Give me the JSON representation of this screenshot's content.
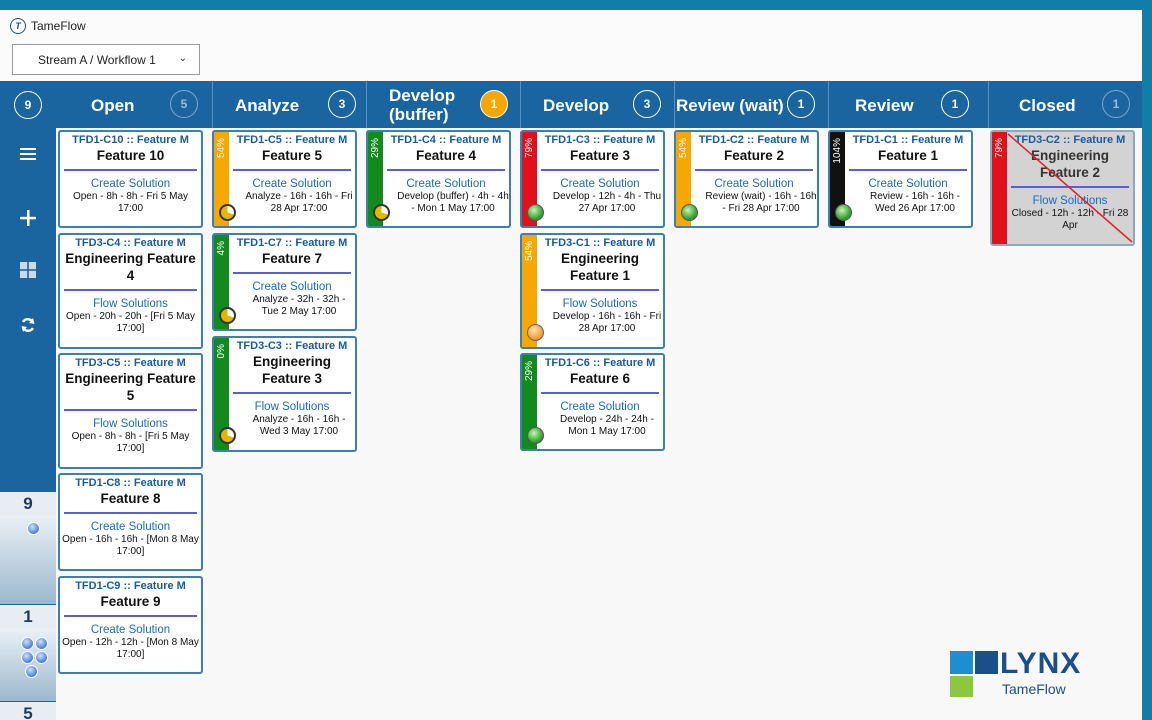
{
  "app": {
    "title": "TameFlow",
    "logo_glyph": "T"
  },
  "stream_select": {
    "value": "Stream A / Workflow 1"
  },
  "header": {
    "total_count": "9",
    "columns": [
      {
        "name": "Open",
        "count": "5"
      },
      {
        "name": "Analyze",
        "count": "3"
      },
      {
        "name": "Develop (buffer)",
        "count": "1"
      },
      {
        "name": "Develop",
        "count": "3"
      },
      {
        "name": "Review (wait)",
        "count": "1"
      },
      {
        "name": "Review",
        "count": "1"
      },
      {
        "name": "Closed",
        "count": "1"
      }
    ]
  },
  "sidebar": {
    "icons": [
      "menu-icon",
      "add-icon",
      "layout-icon",
      "refresh-icon"
    ],
    "lanes": [
      {
        "number": "9"
      },
      {
        "number": "1"
      },
      {
        "number": "5"
      }
    ]
  },
  "cards": {
    "c10": {
      "id": "TFD1-C10 :: Feature M",
      "title": "Feature 10",
      "service": "Create Solution",
      "status": "Open - 8h - 8h - Fri 5 May 17:00"
    },
    "c4e": {
      "id": "TFD3-C4 :: Feature M",
      "title": "Engineering Feature 4",
      "service": "Flow Solutions",
      "status": "Open - 20h - 20h - [Fri 5 May 17:00]"
    },
    "c5e": {
      "id": "TFD3-C5 :: Feature M",
      "title": "Engineering Feature 5",
      "service": "Flow Solutions",
      "status": "Open - 8h - 8h - [Fri 5 May 17:00]"
    },
    "c8": {
      "id": "TFD1-C8 :: Feature M",
      "title": "Feature 8",
      "service": "Create Solution",
      "status": "Open - 16h - 16h - [Mon 8 May 17:00]"
    },
    "c9": {
      "id": "TFD1-C9 :: Feature M",
      "title": "Feature 9",
      "service": "Create Solution",
      "status": "Open - 12h - 12h - [Mon 8 May 17:00]"
    },
    "c5": {
      "id": "TFD1-C5 :: Feature M",
      "title": "Feature 5",
      "service": "Create Solution",
      "status": "Analyze - 16h - 16h - Fri 28 Apr 17:00",
      "progress": "54%"
    },
    "c7": {
      "id": "TFD1-C7 :: Feature M",
      "title": "Feature 7",
      "service": "Create Solution",
      "status": "Analyze - 32h - 32h - Tue 2 May 17:00",
      "progress": "4%"
    },
    "c3e": {
      "id": "TFD3-C3 :: Feature M",
      "title": "Engineering Feature 3",
      "service": "Flow Solutions",
      "status": "Analyze - 16h - 16h - Wed 3 May 17:00",
      "progress": "0%"
    },
    "c4": {
      "id": "TFD1-C4 :: Feature M",
      "title": "Feature 4",
      "service": "Create Solution",
      "status": "Develop (buffer) - 4h - 4h - Mon 1 May 17:00",
      "progress": "29%"
    },
    "c3": {
      "id": "TFD1-C3 :: Feature M",
      "title": "Feature 3",
      "service": "Create Solution",
      "status": "Develop - 12h - 4h - Thu 27 Apr 17:00",
      "progress": "79%"
    },
    "c1e": {
      "id": "TFD3-C1 :: Feature M",
      "title": "Engineering Feature 1",
      "service": "Flow Solutions",
      "status": "Develop - 16h - 16h - Fri 28 Apr 17:00",
      "progress": "54%"
    },
    "c6": {
      "id": "TFD1-C6 :: Feature M",
      "title": "Feature 6",
      "service": "Create Solution",
      "status": "Develop - 24h - 24h - Mon 1 May 17:00",
      "progress": "29%"
    },
    "c2": {
      "id": "TFD1-C2 :: Feature M",
      "title": "Feature 2",
      "service": "Create Solution",
      "status": "Review (wait) - 16h - 16h - Fri 28 Apr 17:00",
      "progress": "54%"
    },
    "c1": {
      "id": "TFD1-C1 :: Feature M",
      "title": "Feature 1",
      "service": "Create Solution",
      "status": "Review - 16h - 16h - Wed 26 Apr 17:00",
      "progress": "104%"
    },
    "c2e": {
      "id": "TFD3-C2 :: Feature M",
      "title": "Engineering Feature 2",
      "service": "Flow Solutions",
      "status": "Closed - 12h - 12h - Fri 28 Apr",
      "progress": "79%"
    }
  },
  "colors": {
    "green": "#138a1d",
    "orange": "#f7a800",
    "red": "#e0111a",
    "black": "#111111",
    "header": "#1a64a0"
  },
  "brand": {
    "name": "LYNX",
    "sub": "TameFlow"
  }
}
